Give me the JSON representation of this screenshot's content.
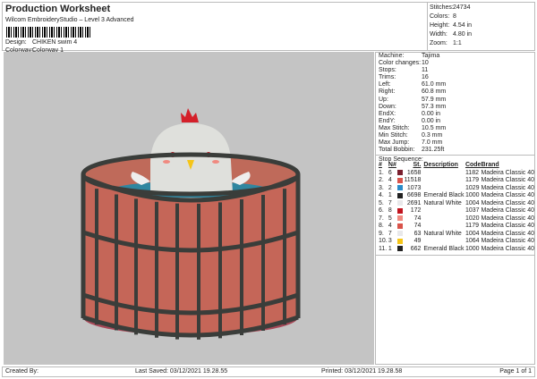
{
  "header": {
    "title": "Production Worksheet",
    "subtitle": "Wilcom EmbroideryStudio – Level 3 Advanced",
    "design_label": "Design:",
    "design": "CHIKEN swim 4",
    "colorway_label": "Colorway:",
    "colorway": "Colorway 1"
  },
  "stats": [
    {
      "k": "Stitches:",
      "v": "24734"
    },
    {
      "k": "Colors:",
      "v": "8"
    },
    {
      "k": "Height:",
      "v": "4.54 in"
    },
    {
      "k": "Width:",
      "v": "4.80 in"
    },
    {
      "k": "Zoom:",
      "v": "1:1"
    }
  ],
  "machine": [
    {
      "k": "Machine:",
      "v": "Tajima"
    },
    {
      "k": "Color changes:",
      "v": "10"
    },
    {
      "k": "Stops:",
      "v": "11"
    },
    {
      "k": "Trims:",
      "v": "16"
    },
    {
      "k": "Left:",
      "v": "61.0 mm"
    },
    {
      "k": "Right:",
      "v": "60.8 mm"
    },
    {
      "k": "Up:",
      "v": "57.9 mm"
    },
    {
      "k": "Down:",
      "v": "57.3 mm"
    },
    {
      "k": "EndX:",
      "v": "0.00 in"
    },
    {
      "k": "EndY:",
      "v": "0.00 in"
    },
    {
      "k": "Max Stitch:",
      "v": "10.5 mm"
    },
    {
      "k": "Min Stitch:",
      "v": "0.3 mm"
    },
    {
      "k": "Max Jump:",
      "v": "7.0 mm"
    },
    {
      "k": "Total Bobbin:",
      "v": "231.25ft"
    }
  ],
  "sequence": {
    "title": "Stop Sequence:",
    "headers": [
      "#",
      "N#",
      "St.",
      "Description",
      "Code",
      "Brand"
    ],
    "rows": [
      {
        "n": "1.",
        "needle": "6",
        "color": "#7a1f2e",
        "st": "1658",
        "desc": "",
        "code": "1182",
        "brand": "Madeira Classic 40"
      },
      {
        "n": "2.",
        "needle": "4",
        "color": "#d9534a",
        "st": "11518",
        "desc": "",
        "code": "1179",
        "brand": "Madeira Classic 40"
      },
      {
        "n": "3.",
        "needle": "2",
        "color": "#2a8cc8",
        "st": "1073",
        "desc": "",
        "code": "1029",
        "brand": "Madeira Classic 40"
      },
      {
        "n": "4.",
        "needle": "1",
        "color": "#222222",
        "st": "6698",
        "desc": "Emerald Black",
        "code": "1000",
        "brand": "Madeira Classic 40"
      },
      {
        "n": "5.",
        "needle": "7",
        "color": "#e8e8ea",
        "st": "2691",
        "desc": "Natural White",
        "code": "1004",
        "brand": "Madeira Classic 40"
      },
      {
        "n": "6.",
        "needle": "8",
        "color": "#c0141e",
        "st": "172",
        "desc": "",
        "code": "1037",
        "brand": "Madeira Classic 40"
      },
      {
        "n": "7.",
        "needle": "5",
        "color": "#f08a80",
        "st": "74",
        "desc": "",
        "code": "1020",
        "brand": "Madeira Classic 40"
      },
      {
        "n": "8.",
        "needle": "4",
        "color": "#d9534a",
        "st": "74",
        "desc": "",
        "code": "1179",
        "brand": "Madeira Classic 40"
      },
      {
        "n": "9.",
        "needle": "7",
        "color": "#e8e8ea",
        "st": "63",
        "desc": "Natural White",
        "code": "1004",
        "brand": "Madeira Classic 40"
      },
      {
        "n": "10.",
        "needle": "3",
        "color": "#f5c518",
        "st": "49",
        "desc": "",
        "code": "1064",
        "brand": "Madeira Classic 40"
      },
      {
        "n": "11.",
        "needle": "1",
        "color": "#222222",
        "st": "662",
        "desc": "Emerald Black",
        "code": "1000",
        "brand": "Madeira Classic 40"
      }
    ]
  },
  "footer": {
    "created": "Created By:",
    "saved": "Last Saved: 03/12/2021 19.28.55",
    "printed": "Printed: 03/12/2021 19.28.58",
    "page": "Page 1 of 1"
  }
}
